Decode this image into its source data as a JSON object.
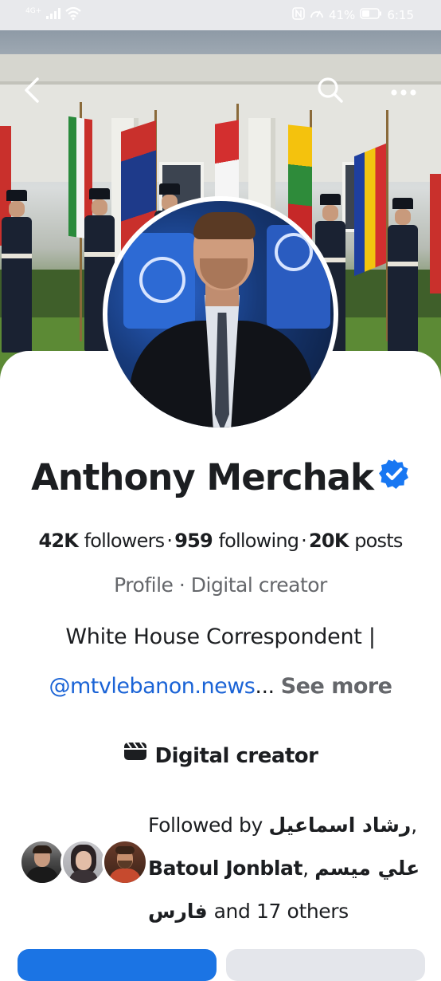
{
  "status_bar": {
    "network": "4G+",
    "battery": "41%",
    "time": "6:15"
  },
  "header": {
    "back_icon": "chevron-left-icon",
    "search_icon": "search-icon",
    "more_icon": "more-horizontal-icon"
  },
  "profile": {
    "name": "Anthony Merchak",
    "verified": true,
    "stats": {
      "followers_value": "42K",
      "followers_label": "followers",
      "following_value": "959",
      "following_label": "following",
      "posts_value": "20K",
      "posts_label": "posts",
      "separator": "·"
    },
    "subtitle": "Profile · Digital creator",
    "bio_line1": "White House Correspondent |",
    "bio_link": "@mtvlebanon.news",
    "bio_ellipsis": "...",
    "see_more": "See more",
    "category": "Digital creator"
  },
  "followed_by": {
    "prefix": "Followed by",
    "name1": "رشاد اسماعيل",
    "comma1": ",",
    "name2": "Batoul Jonblat",
    "comma2": ",",
    "name3": "علي ميسم",
    "name4": "فارس",
    "suffix": "and 17 others"
  },
  "colors": {
    "accent": "#1b74e4",
    "link": "#1a63d6",
    "verified": "#1877f2",
    "secondary_text": "#65676b"
  }
}
